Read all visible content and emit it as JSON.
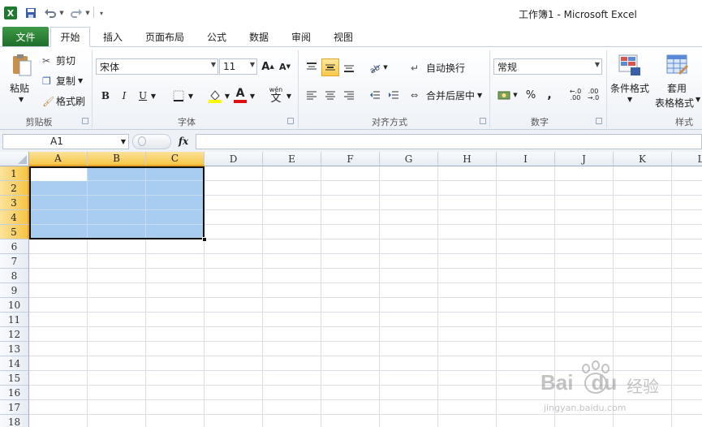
{
  "app": {
    "title": "工作簿1  -  Microsoft Excel",
    "accent": "#1f6e2a",
    "selection_color": "#a9cdf0",
    "header_highlight": "#f6c544"
  },
  "quick_access": {
    "icons": [
      "excel-logo-icon",
      "save-icon",
      "undo-icon",
      "redo-icon",
      "customize-icon"
    ]
  },
  "tabs": {
    "file": "文件",
    "items": [
      {
        "label": "开始",
        "active": true
      },
      {
        "label": "插入"
      },
      {
        "label": "页面布局"
      },
      {
        "label": "公式"
      },
      {
        "label": "数据"
      },
      {
        "label": "审阅"
      },
      {
        "label": "视图"
      }
    ]
  },
  "ribbon": {
    "clipboard": {
      "paste": "粘贴",
      "cut": "剪切",
      "copy": "复制",
      "format_painter": "格式刷",
      "group_label": "剪贴板"
    },
    "font": {
      "font_name": "宋体",
      "font_size": "11",
      "bold": "B",
      "italic": "I",
      "underline": "U",
      "font_color_letter": "A",
      "phonetic": "wén",
      "phonetic_char": "文",
      "group_label": "字体"
    },
    "alignment": {
      "wrap_text": "自动换行",
      "merge_center": "合并后居中",
      "group_label": "对齐方式"
    },
    "number": {
      "format": "常规",
      "percent": "%",
      "comma": ",",
      "inc_decimal": "←.0 .00",
      "dec_decimal": ".00 →.0",
      "group_label": "数字"
    },
    "styles": {
      "conditional": "条件格式",
      "table_format_1": "套用",
      "table_format_2": "表格格式",
      "group_label": "样式"
    }
  },
  "formula_bar": {
    "name_box": "A1",
    "fx": "fx",
    "value": ""
  },
  "grid": {
    "columns": [
      "A",
      "B",
      "C",
      "D",
      "E",
      "F",
      "G",
      "H",
      "I",
      "J",
      "K",
      "L"
    ],
    "rows": [
      "1",
      "2",
      "3",
      "4",
      "5",
      "6",
      "7",
      "8",
      "9",
      "10",
      "11",
      "12",
      "13",
      "14",
      "15",
      "16",
      "17",
      "18"
    ],
    "selected_columns": [
      "A",
      "B",
      "C"
    ],
    "selected_rows": [
      "1",
      "2",
      "3",
      "4",
      "5"
    ],
    "selection": "A1:C5",
    "active_cell": "A1"
  },
  "watermark": {
    "brand": "Bai",
    "brand2": "du",
    "brand_cn": "经验",
    "url": "jingyan.baidu.com"
  }
}
